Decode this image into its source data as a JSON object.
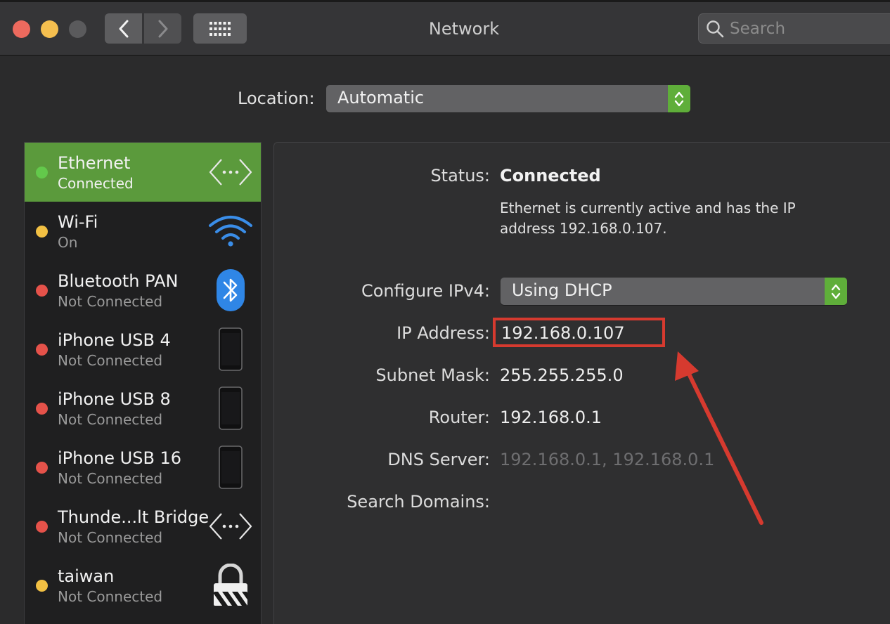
{
  "window": {
    "title": "Network"
  },
  "toolbar": {
    "search_placeholder": "Search",
    "icons": [
      "back-icon",
      "forward-icon",
      "grid-icon",
      "search-icon"
    ]
  },
  "location": {
    "label": "Location:",
    "value": "Automatic"
  },
  "services": [
    {
      "name": "Ethernet",
      "status": "Connected",
      "indicator": "green",
      "icon": "ethernet-icon",
      "selected": true
    },
    {
      "name": "Wi-Fi",
      "status": "On",
      "indicator": "yellow",
      "icon": "wifi-icon",
      "selected": false
    },
    {
      "name": "Bluetooth PAN",
      "status": "Not Connected",
      "indicator": "red",
      "icon": "bluetooth-icon",
      "selected": false
    },
    {
      "name": "iPhone USB 4",
      "status": "Not Connected",
      "indicator": "red",
      "icon": "iphone-icon",
      "selected": false
    },
    {
      "name": "iPhone USB 8",
      "status": "Not Connected",
      "indicator": "red",
      "icon": "iphone-icon",
      "selected": false
    },
    {
      "name": "iPhone USB 16",
      "status": "Not Connected",
      "indicator": "red",
      "icon": "iphone-icon",
      "selected": false
    },
    {
      "name": "Thunde...lt Bridge",
      "status": "Not Connected",
      "indicator": "red",
      "icon": "ethernet-icon",
      "selected": false
    },
    {
      "name": "taiwan",
      "status": "Not Connected",
      "indicator": "yellow",
      "icon": "lock-icon",
      "selected": false
    }
  ],
  "detail": {
    "status_label": "Status:",
    "status_value": "Connected",
    "status_description": "Ethernet is currently active and has the IP address 192.168.0.107.",
    "configure_label": "Configure IPv4:",
    "configure_value": "Using DHCP",
    "ip_label": "IP Address:",
    "ip_value": "192.168.0.107",
    "subnet_label": "Subnet Mask:",
    "subnet_value": "255.255.255.0",
    "router_label": "Router:",
    "router_value": "192.168.0.1",
    "dns_label": "DNS Server:",
    "dns_value": "192.168.0.1, 192.168.0.1",
    "search_domains_label": "Search Domains:"
  },
  "colors": {
    "accent_green": "#5b9a3c",
    "stepper_green": "#5fae3a",
    "status_green": "#63c94b",
    "status_yellow": "#f2c043",
    "status_red": "#e5524a",
    "annotation_red": "#d63a2f"
  },
  "annotation": {
    "type": "highlight-box-with-arrow",
    "target": "ip-address-value"
  }
}
